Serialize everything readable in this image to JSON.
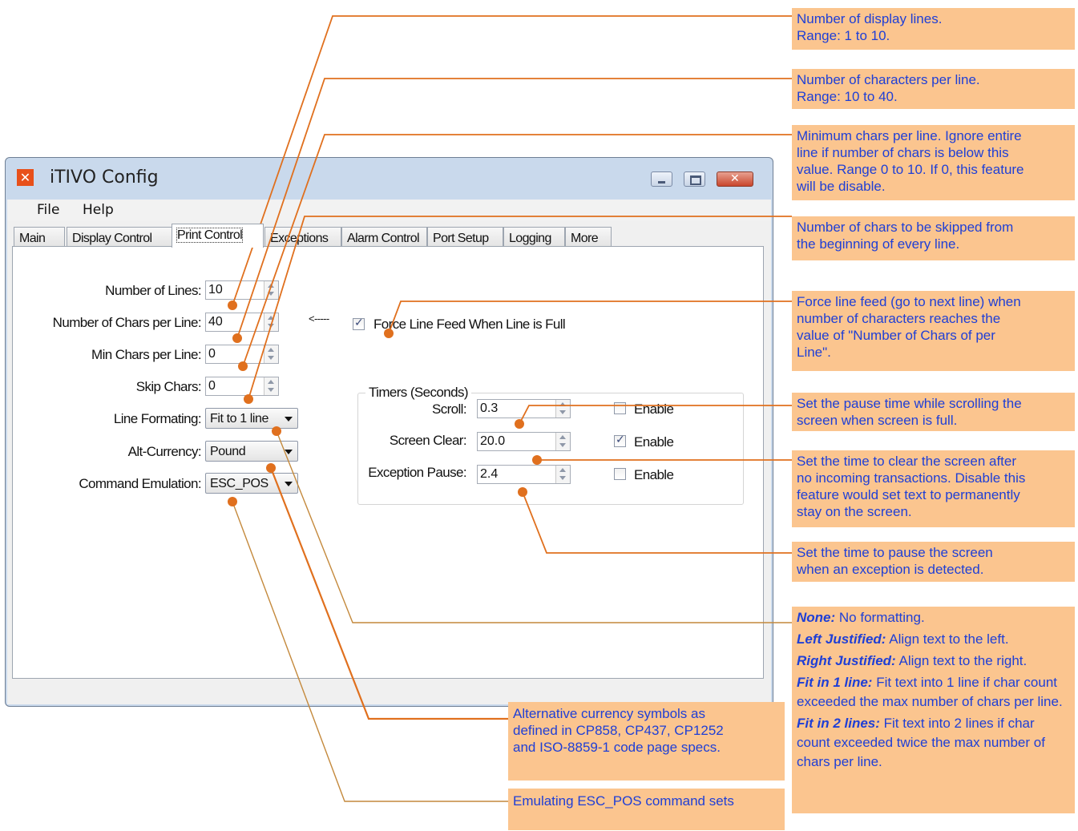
{
  "window": {
    "title": "iTIVO Config",
    "icon": "app-x-icon"
  },
  "menu": [
    "File",
    "Help"
  ],
  "tabs": [
    "Main",
    "Display Control",
    "Print Control",
    "Exceptions",
    "Alarm Control",
    "Port Setup",
    "Logging",
    "More"
  ],
  "active_tab": "Print Control",
  "fields": {
    "lines": {
      "label": "Number of Lines:",
      "value": "10"
    },
    "chars": {
      "label": "Number of Chars per Line:",
      "value": "40"
    },
    "min_chars": {
      "label": "Min Chars per Line:",
      "value": "0"
    },
    "skip": {
      "label": "Skip Chars:",
      "value": "0"
    },
    "line_format": {
      "label": "Line Formating:",
      "value": "Fit to 1 line"
    },
    "currency": {
      "label": "Alt-Currency:",
      "value": "Pound"
    },
    "emulation": {
      "label": "Command Emulation:",
      "value": "ESC_POS"
    }
  },
  "force_feed": {
    "arrow": "<-----",
    "label": "Force Line Feed When Line is Full",
    "checked": true
  },
  "timers": {
    "title": "Timers (Seconds)",
    "scroll": {
      "label": "Scroll:",
      "value": "0.3",
      "enable": "Enable",
      "checked": false
    },
    "clear": {
      "label": "Screen Clear:",
      "value": "20.0",
      "enable": "Enable",
      "checked": true
    },
    "exception": {
      "label": "Exception Pause:",
      "value": "2.4",
      "enable": "Enable",
      "checked": false
    }
  },
  "notes": {
    "n1": [
      "Number of display lines.",
      "Range: 1 to 10."
    ],
    "n2": [
      "Number of characters per line.",
      "Range: 10 to 40."
    ],
    "n3": [
      "Minimum chars per line. Ignore entire",
      "line if number of chars is below this",
      "value. Range 0 to 10. If 0, this feature",
      "will be disable."
    ],
    "n4": [
      "Number of chars to be skipped from",
      "the beginning of every line."
    ],
    "n5": [
      "Force line feed (go to next line) when",
      "number of characters reaches the",
      "value of \"Number of Chars of per",
      "Line\"."
    ],
    "n6": [
      "Set the pause time while scrolling the",
      "screen when screen is full."
    ],
    "n7": [
      "Set the time to clear the screen after",
      "no incoming transactions. Disable this",
      "feature would set text to permanently",
      "stay on the screen."
    ],
    "n8": [
      "Set the time to pause the screen",
      "when an exception is detected."
    ],
    "n9": [
      "Alternative currency symbols as",
      "defined in CP858, CP437, CP1252",
      "and ISO-8859-1 code page specs."
    ],
    "n10": [
      "Emulating ESC_POS command sets"
    ],
    "formats": [
      {
        "term": "None:",
        "desc": "No formatting."
      },
      {
        "term": "Left Justified:",
        "desc": "Align text to the left."
      },
      {
        "term": "Right Justified:",
        "desc": "Align text to the right."
      },
      {
        "term": "Fit in 1 line:",
        "desc": "Fit text into 1 line if char count exceeded the max number of chars per line."
      },
      {
        "term": "Fit in 2 lines:",
        "desc": "Fit text into 2 lines if char count exceeded twice the max number of chars per line."
      }
    ]
  },
  "colors": {
    "callout_bg": "#fbc58f",
    "callout_text": "#1f3fd6",
    "leader_line": "#e0701e",
    "window_frame": "#c9d9ec"
  }
}
